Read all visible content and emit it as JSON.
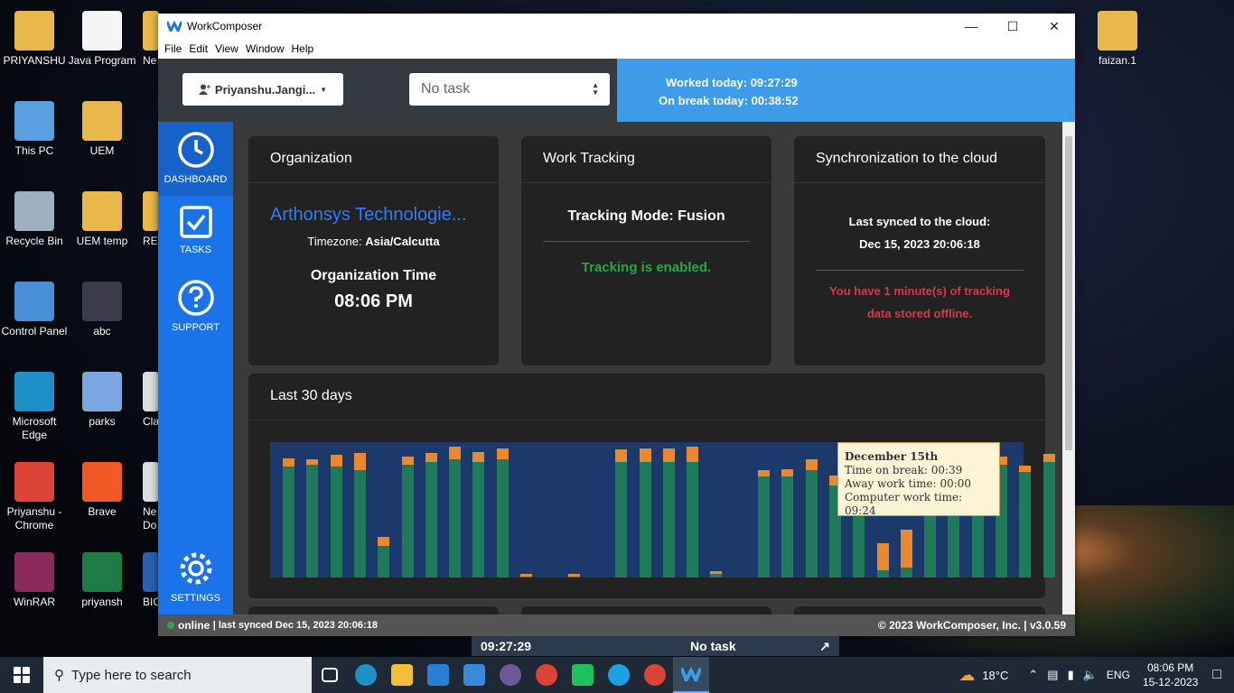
{
  "desktop": {
    "icons_left": [
      {
        "label": "PRIYANSHU",
        "x": "p"
      },
      {
        "label": "Java Program"
      },
      {
        "label": "Ne"
      },
      {
        "label": "This PC"
      },
      {
        "label": "UEM"
      },
      {
        "label": "Recycle Bin"
      },
      {
        "label": "UEM temp"
      },
      {
        "label": "REs"
      },
      {
        "label": "Control Panel"
      },
      {
        "label": "abc"
      },
      {
        "label": "Microsoft Edge"
      },
      {
        "label": "parks"
      },
      {
        "label": "Clas"
      },
      {
        "label": "Priyanshu - Chrome"
      },
      {
        "label": "Brave"
      },
      {
        "label": "Ne Do"
      },
      {
        "label": "WinRAR"
      },
      {
        "label": "priyansh"
      },
      {
        "label": "BIC"
      }
    ],
    "icon_right": "faizan.1"
  },
  "window": {
    "title": "WorkComposer",
    "menu": [
      "File",
      "Edit",
      "View",
      "Window",
      "Help"
    ]
  },
  "topbar": {
    "user": "Priyanshu.Jangi...",
    "task_placeholder": "No task",
    "worked_label": "Worked today:",
    "worked_value": "09:27:29",
    "break_label": "On break today:",
    "break_value": "00:38:52"
  },
  "sidebar": {
    "dashboard": "DASHBOARD",
    "tasks": "TASKS",
    "support": "SUPPORT",
    "settings": "SETTINGS"
  },
  "org": {
    "title": "Organization",
    "name": "Arthonsys Technologie...",
    "tz_label": "Timezone:",
    "tz_value": "Asia/Calcutta",
    "time_label": "Organization Time",
    "time_value": "08:06 PM"
  },
  "tracking": {
    "title": "Work Tracking",
    "mode": "Tracking Mode: Fusion",
    "status": "Tracking is enabled."
  },
  "sync": {
    "title": "Synchronization to the cloud",
    "last_label": "Last synced to the cloud:",
    "last_value": "Dec 15, 2023 20:06:18",
    "warning_line1": "You have 1 minute(s) of tracking",
    "warning_line2": "data stored offline."
  },
  "last30": {
    "title": "Last 30 days"
  },
  "tooltip": {
    "date": "December 15th",
    "break": "Time on break: 00:39",
    "away": "Away work time: 00:00",
    "computer": "Computer work time: 09:24"
  },
  "chart_data": {
    "type": "bar",
    "stacked": true,
    "series": [
      {
        "name": "Computer work time",
        "values": [
          9.0,
          9.2,
          9.0,
          8.7,
          2.6,
          9.2,
          9.4,
          9.6,
          9.4,
          9.6,
          0.1,
          0,
          0.1,
          0,
          9.4,
          9.4,
          9.4,
          9.4,
          0.3,
          0,
          8.2,
          8.2,
          8.7,
          7.5,
          9.0,
          0.6,
          0.8,
          8.8,
          9.0,
          9.0,
          9.2,
          8.6,
          9.4
        ],
        "color": "#1e7a5a"
      },
      {
        "name": "Time on break",
        "values": [
          0.7,
          0.4,
          1.0,
          1.4,
          0.7,
          0.6,
          0.7,
          1.0,
          0.8,
          0.9,
          0.2,
          0,
          0.2,
          0,
          1.0,
          1.1,
          1.1,
          1.2,
          0.2,
          0,
          0.5,
          0.6,
          0.9,
          0.8,
          0.6,
          2.2,
          3.1,
          0.6,
          0.6,
          0.6,
          0.6,
          0.5,
          0.65
        ],
        "color": "#e8892f"
      }
    ],
    "ylim": [
      0,
      11
    ]
  },
  "status": {
    "online": "online",
    "synced": "| last synced Dec 15, 2023 20:06:18",
    "copyright": "© 2023 WorkComposer, Inc. | v3.0.59"
  },
  "floater": {
    "time": "09:27:29",
    "task": "No task"
  },
  "taskbar": {
    "search_placeholder": "Type here to search",
    "temp": "18°C",
    "lang": "ENG",
    "clock_time": "08:06 PM",
    "clock_date": "15-12-2023"
  },
  "colors": {
    "accent": "#1a73e8",
    "green": "#28a745",
    "red": "#dc3545",
    "link": "#2f7cf6"
  }
}
